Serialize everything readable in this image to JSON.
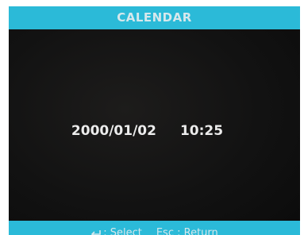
{
  "header": {
    "title": "CALENDAR"
  },
  "main": {
    "date": "2000/01/02",
    "time": "10:25"
  },
  "footer": {
    "select_key_icon": "enter-key-icon",
    "select_label": ": Select",
    "return_label": "Esc : Return"
  },
  "colors": {
    "bar": "#2bbad8",
    "background": "#121212",
    "text": "#ececec"
  }
}
